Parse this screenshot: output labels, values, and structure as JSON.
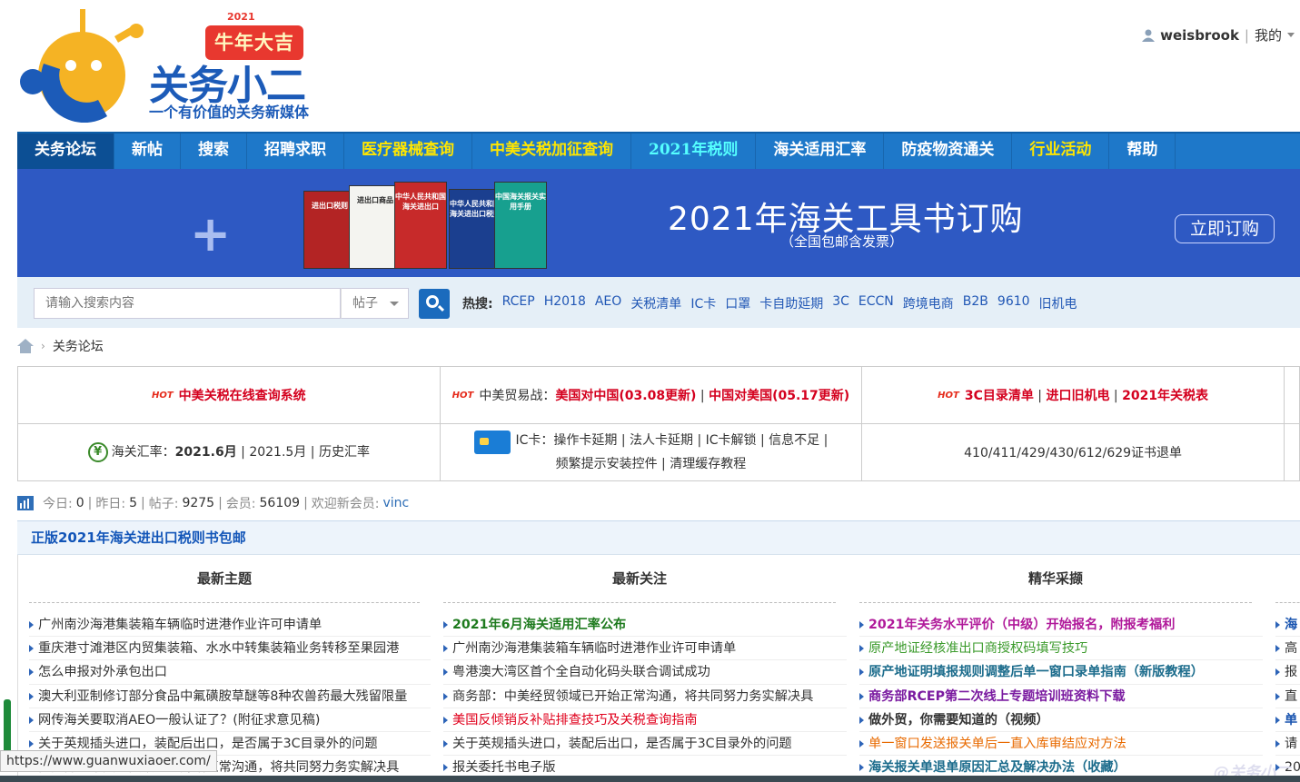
{
  "logo": {
    "badge_year": "2021",
    "badge": "牛年大吉",
    "name": "关务小二",
    "slogan": "一个有价值的关务新媒体"
  },
  "user": {
    "username": "weisbrook",
    "separator": "|",
    "my": "我的"
  },
  "nav": [
    {
      "label": "关务论坛",
      "style": "active"
    },
    {
      "label": "新帖",
      "style": ""
    },
    {
      "label": "搜索",
      "style": ""
    },
    {
      "label": "招聘求职",
      "style": ""
    },
    {
      "label": "医疗器械查询",
      "style": "hl"
    },
    {
      "label": "中美关税加征查询",
      "style": "hl"
    },
    {
      "label": "2021年税则",
      "style": "cyan"
    },
    {
      "label": "海关适用汇率",
      "style": ""
    },
    {
      "label": "防疫物资通关",
      "style": ""
    },
    {
      "label": "行业活动",
      "style": "hl"
    },
    {
      "label": "帮助",
      "style": ""
    }
  ],
  "banner": {
    "title": "2021年海关工具书订购",
    "subtitle": "（全国包邮含发票）",
    "button": "立即订购",
    "books": [
      "进出口税则",
      "进出口商品",
      "中华人民共和国海关进出口",
      "中华人民共和国海关进出口税则",
      "中国海关报关实用手册"
    ]
  },
  "search": {
    "placeholder": "请输入搜索内容",
    "type": "帖子",
    "hot_label": "热搜:",
    "hot_terms": [
      "RCEP",
      "H2018",
      "AEO",
      "关税清单",
      "IC卡",
      "口罩",
      "卡自助延期",
      "3C",
      "ECCN",
      "跨境电商",
      "B2B",
      "9610",
      "旧机电"
    ]
  },
  "breadcrumb": {
    "arrow": "›",
    "current": "关务论坛"
  },
  "quick": {
    "hot_tag": "HOT",
    "tariff_system": "中美关税在线查询系统",
    "trade_war_prefix": "中美贸易战：",
    "us_to_cn": "美国对中国(03.08更新)",
    "sep": "|",
    "cn_to_us": "中国对美国(05.17更新)",
    "ccc_list": "3C目录清单",
    "old_mech": "进口旧机电",
    "tariff2021": "2021年关税表",
    "rate_prefix": "海关汇率：",
    "rate_current": "2021.6月",
    "rate_prev": "2021.5月",
    "rate_history": "历史汇率",
    "yen_symbol": "¥",
    "ic_line1": "IC卡：操作卡延期 | 法人卡延期 | IC卡解锁 | 信息不足 |",
    "ic_line2": "频繁提示安装控件 | 清理缓存教程",
    "refund": "410/411/429/430/612/629证书退单"
  },
  "stats": {
    "today_label": "今日:",
    "today": "0",
    "yesterday_label": "昨日:",
    "yesterday": "5",
    "posts_label": "帖子:",
    "posts": "9275",
    "members_label": "会员:",
    "members": "56109",
    "newest_label": "欢迎新会员:",
    "newest": "vinc",
    "sep": "|"
  },
  "promo": "正版2021年海关进出口税则书包邮",
  "columns": [
    {
      "title": "最新主题",
      "items": [
        {
          "text": "广州南沙海港集装箱车辆临时进港作业许可申请单",
          "style": ""
        },
        {
          "text": "重庆港寸滩港区内贸集装箱、水水中转集装箱业务转移至果园港",
          "style": ""
        },
        {
          "text": "怎么申报对外承包出口",
          "style": ""
        },
        {
          "text": "澳大利亚制修订部分食品中氟磺胺草醚等8种农兽药最大残留限量",
          "style": ""
        },
        {
          "text": "网传海关要取消AEO一般认证了？(附征求意见稿)",
          "style": ""
        },
        {
          "text": "关于英规插头进口，装配后出口，是否属于3C目录外的问题",
          "style": ""
        },
        {
          "text": "商务部：中美经贸领域已开始正常沟通，将共同努力务实解决具",
          "style": ""
        }
      ]
    },
    {
      "title": "最新关注",
      "items": [
        {
          "text": "2021年6月海关适用汇率公布",
          "style": "g"
        },
        {
          "text": "广州南沙海港集装箱车辆临时进港作业许可申请单",
          "style": ""
        },
        {
          "text": "粤港澳大湾区首个全自动化码头联合调试成功",
          "style": ""
        },
        {
          "text": "商务部：中美经贸领域已开始正常沟通，将共同努力务实解决具",
          "style": ""
        },
        {
          "text": "美国反倾销反补贴排查技巧及关税查询指南",
          "style": "r"
        },
        {
          "text": "关于英规插头进口，装配后出口，是否属于3C目录外的问题",
          "style": ""
        },
        {
          "text": "报关委托书电子版",
          "style": ""
        }
      ]
    },
    {
      "title": "精华采撷",
      "items": [
        {
          "text": "2021年关务水平评价（中级）开始报名，附报考福利",
          "style": "p"
        },
        {
          "text": "原产地证经核准出口商授权码填写技巧",
          "style": "gr"
        },
        {
          "text": "原产地证明填报规则调整后单一窗口录单指南（新版教程）",
          "style": "t"
        },
        {
          "text": "商务部RCEP第二次线上专题培训班资料下载",
          "style": "pur"
        },
        {
          "text": "做外贸，你需要知道的（视频）",
          "style": "b"
        },
        {
          "text": "单一窗口发送报关单后一直入库审结应对方法",
          "style": "or"
        },
        {
          "text": "海关报关单退单原因汇总及解决办法（收藏）",
          "style": "t"
        }
      ]
    },
    {
      "title": "",
      "items": [
        {
          "text": "海",
          "style": "bl"
        },
        {
          "text": "高",
          "style": ""
        },
        {
          "text": "报",
          "style": ""
        },
        {
          "text": "直",
          "style": ""
        },
        {
          "text": "单",
          "style": "bl"
        },
        {
          "text": "请",
          "style": ""
        },
        {
          "text": "20",
          "style": ""
        }
      ]
    }
  ],
  "status_url": "https://www.guanwuxiaoer.com/",
  "watermark": "@关务小二",
  "colors": {
    "nav_bg": "#1e78c9",
    "nav_active": "#0c4f94",
    "highlight_yellow": "#ffe600",
    "banner_bg": "#2e59c3",
    "link_blue": "#2157b5",
    "red": "#d4001e"
  }
}
